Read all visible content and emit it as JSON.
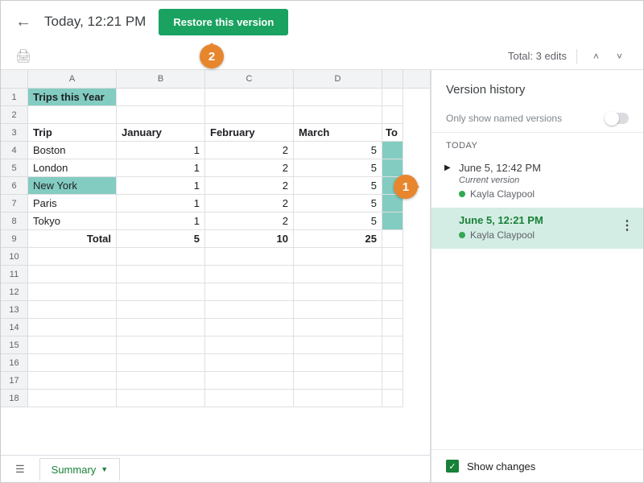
{
  "header": {
    "title": "Today, 12:21 PM",
    "restore_label": "Restore this version"
  },
  "toolbar": {
    "edit_summary": "Total: 3 edits"
  },
  "sheet": {
    "columns": [
      "A",
      "B",
      "C",
      "D"
    ],
    "partial_col": "To",
    "rows": [
      {
        "n": "1",
        "cells": [
          "Trips this Year",
          "",
          "",
          ""
        ],
        "bold": true,
        "hl": [
          0
        ]
      },
      {
        "n": "2",
        "cells": [
          "",
          "",
          "",
          ""
        ]
      },
      {
        "n": "3",
        "cells": [
          "Trip",
          "January",
          "February",
          "March"
        ],
        "bold": true
      },
      {
        "n": "4",
        "cells": [
          "Boston",
          "1",
          "2",
          "5"
        ]
      },
      {
        "n": "5",
        "cells": [
          "London",
          "1",
          "2",
          "5"
        ]
      },
      {
        "n": "6",
        "cells": [
          "New York",
          "1",
          "2",
          "5"
        ],
        "hl": [
          0
        ]
      },
      {
        "n": "7",
        "cells": [
          "Paris",
          "1",
          "2",
          "5"
        ]
      },
      {
        "n": "8",
        "cells": [
          "Tokyo",
          "1",
          "2",
          "5"
        ]
      },
      {
        "n": "9",
        "cells": [
          "Total",
          "5",
          "10",
          "25"
        ],
        "bold": true
      },
      {
        "n": "10",
        "cells": [
          "",
          "",
          "",
          ""
        ]
      },
      {
        "n": "11",
        "cells": [
          "",
          "",
          "",
          ""
        ]
      },
      {
        "n": "12",
        "cells": [
          "",
          "",
          "",
          ""
        ]
      },
      {
        "n": "13",
        "cells": [
          "",
          "",
          "",
          ""
        ]
      },
      {
        "n": "14",
        "cells": [
          "",
          "",
          "",
          ""
        ]
      },
      {
        "n": "15",
        "cells": [
          "",
          "",
          "",
          ""
        ]
      },
      {
        "n": "16",
        "cells": [
          "",
          "",
          "",
          ""
        ]
      },
      {
        "n": "17",
        "cells": [
          "",
          "",
          "",
          ""
        ]
      },
      {
        "n": "18",
        "cells": [
          "",
          "",
          "",
          ""
        ]
      }
    ],
    "ecol_hl_rows": [
      "4",
      "5",
      "6",
      "7",
      "8"
    ],
    "tab_label": "Summary"
  },
  "sidebar": {
    "title": "Version history",
    "named_only": "Only show named versions",
    "section": "TODAY",
    "versions": [
      {
        "time": "June 5, 12:42 PM",
        "sub": "Current version",
        "author": "Kayla Claypool",
        "caret": true
      },
      {
        "time": "June 5, 12:21 PM",
        "author": "Kayla Claypool",
        "selected": true
      }
    ],
    "show_changes": "Show changes"
  },
  "callouts": {
    "one": "1",
    "two": "2"
  }
}
